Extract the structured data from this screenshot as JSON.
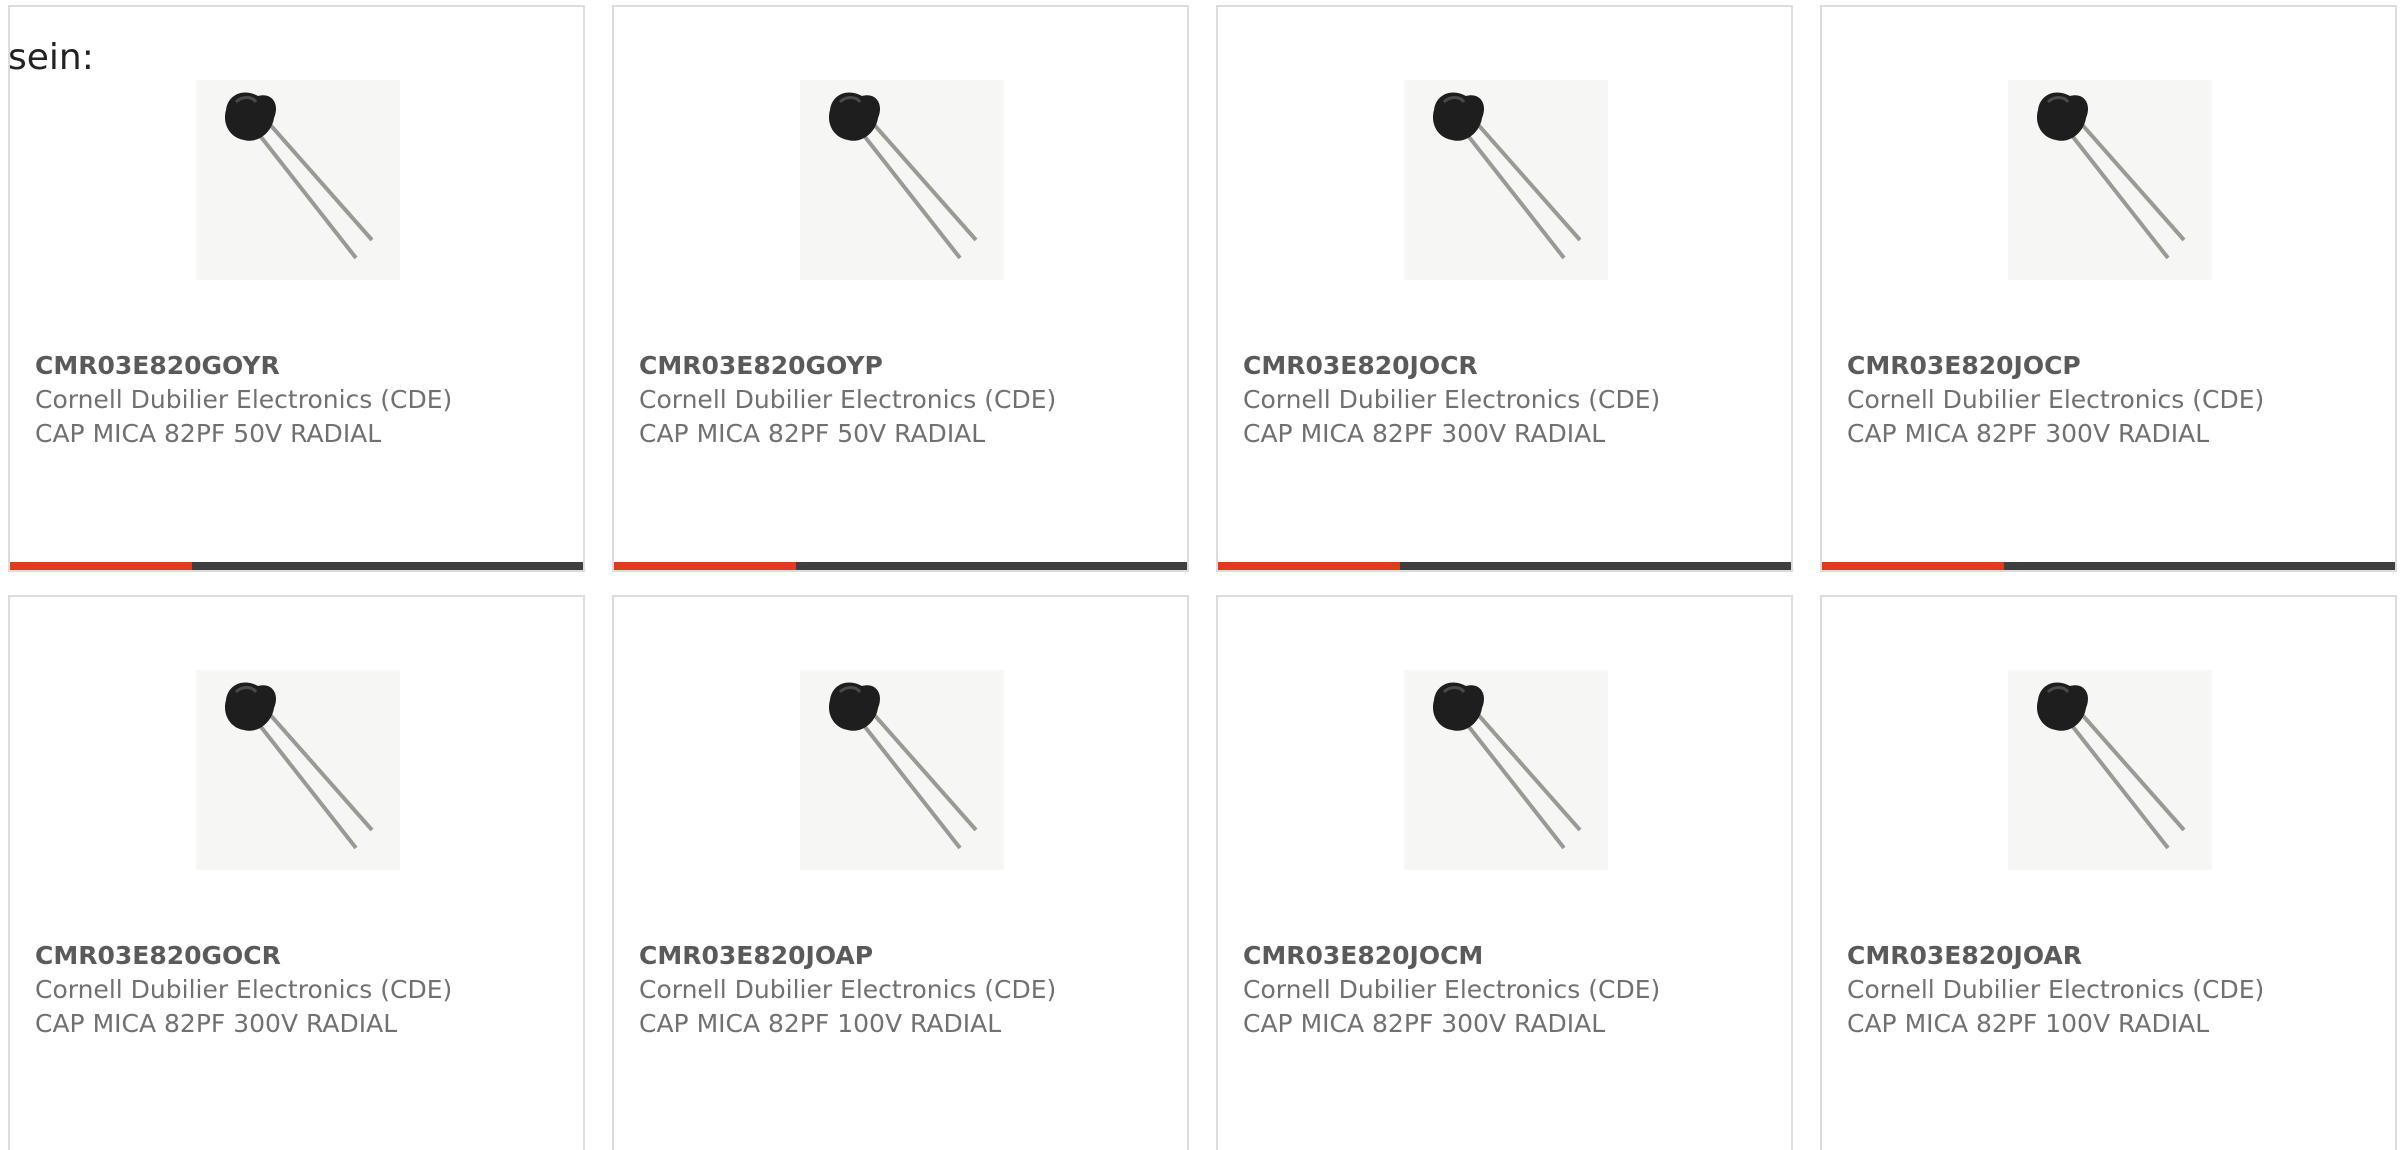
{
  "intro": "sein:",
  "colors": {
    "accent": "#e03c1c",
    "bar": "#3f3f3f",
    "border": "#dcdcdc",
    "title": "#5a5a5a",
    "text": "#707070"
  },
  "products": [
    {
      "part_number": "CMR03E820GOYR",
      "manufacturer": "Cornell Dubilier Electronics (CDE)",
      "description": "CAP MICA 82PF 50V RADIAL",
      "image_icon": "capacitor-image"
    },
    {
      "part_number": "CMR03E820GOYP",
      "manufacturer": "Cornell Dubilier Electronics (CDE)",
      "description": "CAP MICA 82PF 50V RADIAL",
      "image_icon": "capacitor-image"
    },
    {
      "part_number": "CMR03E820JOCR",
      "manufacturer": "Cornell Dubilier Electronics (CDE)",
      "description": "CAP MICA 82PF 300V RADIAL",
      "image_icon": "capacitor-image"
    },
    {
      "part_number": "CMR03E820JOCP",
      "manufacturer": "Cornell Dubilier Electronics (CDE)",
      "description": "CAP MICA 82PF 300V RADIAL",
      "image_icon": "capacitor-image"
    },
    {
      "part_number": "CMR03E820GOCR",
      "manufacturer": "Cornell Dubilier Electronics (CDE)",
      "description": "CAP MICA 82PF 300V RADIAL",
      "image_icon": "capacitor-image"
    },
    {
      "part_number": "CMR03E820JOAP",
      "manufacturer": "Cornell Dubilier Electronics (CDE)",
      "description": "CAP MICA 82PF 100V RADIAL",
      "image_icon": "capacitor-image"
    },
    {
      "part_number": "CMR03E820JOCM",
      "manufacturer": "Cornell Dubilier Electronics (CDE)",
      "description": "CAP MICA 82PF 300V RADIAL",
      "image_icon": "capacitor-image"
    },
    {
      "part_number": "CMR03E820JOAR",
      "manufacturer": "Cornell Dubilier Electronics (CDE)",
      "description": "CAP MICA 82PF 100V RADIAL",
      "image_icon": "capacitor-image"
    }
  ]
}
